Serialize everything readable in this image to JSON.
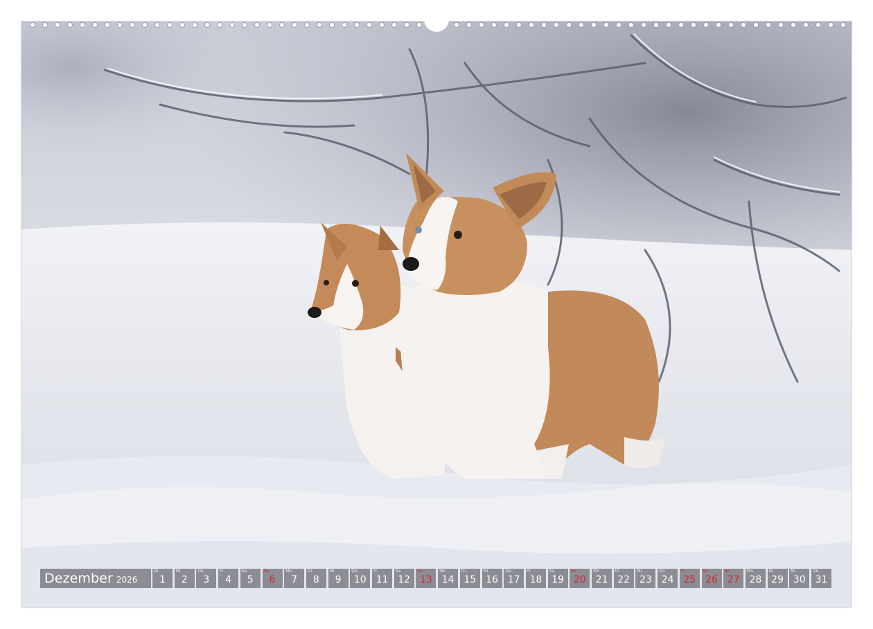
{
  "calendar": {
    "month": "Dezember",
    "year": "2026",
    "colors": {
      "strip": "#78787f",
      "text": "#ffffff",
      "holiday": "#e0202a"
    },
    "days": [
      {
        "wd": "Di",
        "d": "1",
        "holiday": false
      },
      {
        "wd": "Mi",
        "d": "2",
        "holiday": false
      },
      {
        "wd": "Do",
        "d": "3",
        "holiday": false
      },
      {
        "wd": "Fr",
        "d": "4",
        "holiday": false
      },
      {
        "wd": "Sa",
        "d": "5",
        "holiday": false
      },
      {
        "wd": "So",
        "d": "6",
        "holiday": true
      },
      {
        "wd": "Mo",
        "d": "7",
        "holiday": false
      },
      {
        "wd": "Di",
        "d": "8",
        "holiday": false
      },
      {
        "wd": "Mi",
        "d": "9",
        "holiday": false
      },
      {
        "wd": "Do",
        "d": "10",
        "holiday": false
      },
      {
        "wd": "Fr",
        "d": "11",
        "holiday": false
      },
      {
        "wd": "Sa",
        "d": "12",
        "holiday": false
      },
      {
        "wd": "So",
        "d": "13",
        "holiday": true
      },
      {
        "wd": "Mo",
        "d": "14",
        "holiday": false
      },
      {
        "wd": "Di",
        "d": "15",
        "holiday": false
      },
      {
        "wd": "Mi",
        "d": "16",
        "holiday": false
      },
      {
        "wd": "Do",
        "d": "17",
        "holiday": false
      },
      {
        "wd": "Fr",
        "d": "18",
        "holiday": false
      },
      {
        "wd": "Sa",
        "d": "19",
        "holiday": false
      },
      {
        "wd": "So",
        "d": "20",
        "holiday": true
      },
      {
        "wd": "Mo",
        "d": "21",
        "holiday": false
      },
      {
        "wd": "Di",
        "d": "22",
        "holiday": false
      },
      {
        "wd": "Mi",
        "d": "23",
        "holiday": false
      },
      {
        "wd": "Do",
        "d": "24",
        "holiday": false
      },
      {
        "wd": "Fr",
        "d": "25",
        "holiday": true
      },
      {
        "wd": "Sa",
        "d": "26",
        "holiday": true
      },
      {
        "wd": "So",
        "d": "27",
        "holiday": true
      },
      {
        "wd": "Mo",
        "d": "28",
        "holiday": false
      },
      {
        "wd": "Di",
        "d": "29",
        "holiday": false
      },
      {
        "wd": "Mi",
        "d": "30",
        "holiday": false
      },
      {
        "wd": "Do",
        "d": "31",
        "holiday": false
      }
    ]
  }
}
